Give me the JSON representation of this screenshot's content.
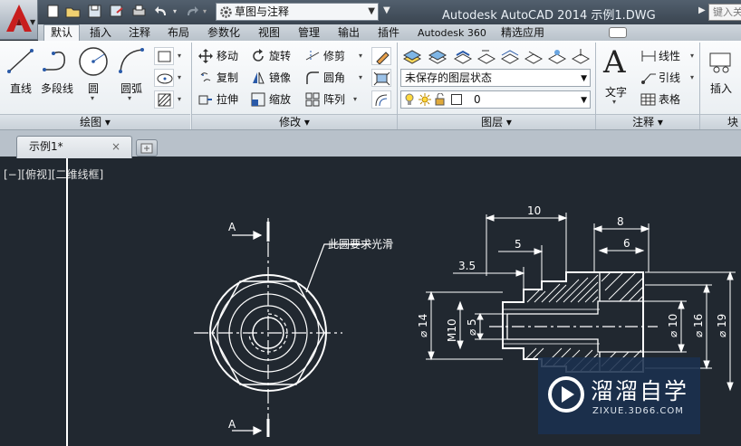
{
  "titlebar": {
    "workspace": "草图与注释",
    "title": "Autodesk AutoCAD 2014    示例1.DWG",
    "search_placeholder": "键入关键字"
  },
  "ribbon_tabs": [
    "默认",
    "插入",
    "注释",
    "布局",
    "参数化",
    "视图",
    "管理",
    "输出",
    "插件",
    "Autodesk 360",
    "精选应用"
  ],
  "panels": {
    "draw": {
      "title": "绘图 ▾",
      "tools": [
        "直线",
        "多段线",
        "圆",
        "圆弧"
      ]
    },
    "modify": {
      "title": "修改 ▾",
      "tools": [
        "移动",
        "旋转",
        "修剪",
        "复制",
        "镜像",
        "圆角",
        "拉伸",
        "缩放",
        "阵列"
      ]
    },
    "layers": {
      "title": "图层 ▾",
      "state": "未保存的图层状态",
      "current_layer": "0"
    },
    "annotation": {
      "title": "注释 ▾",
      "text_tool": "文字",
      "tools": [
        "线性",
        "引线",
        "表格"
      ]
    },
    "block": {
      "insert": "插入",
      "title": "块"
    }
  },
  "file_tab": {
    "name": "示例1*",
    "close": "×"
  },
  "viewport_label": "[−][俯视][二维线框]",
  "drawing": {
    "section_marker_top": "A",
    "section_marker_bottom": "A",
    "note": "此圆要求光滑",
    "dims_top": [
      "10",
      "5",
      "3.5",
      "8",
      "6"
    ],
    "dims_left": [
      "⌀ 14",
      "M10",
      "⌀ 5"
    ],
    "dims_right": [
      "⌀ 10",
      "⌀ 16",
      "⌀ 19"
    ]
  },
  "watermark": {
    "title": "溜溜自学",
    "url": "ZIXUE.3D66.COM"
  }
}
